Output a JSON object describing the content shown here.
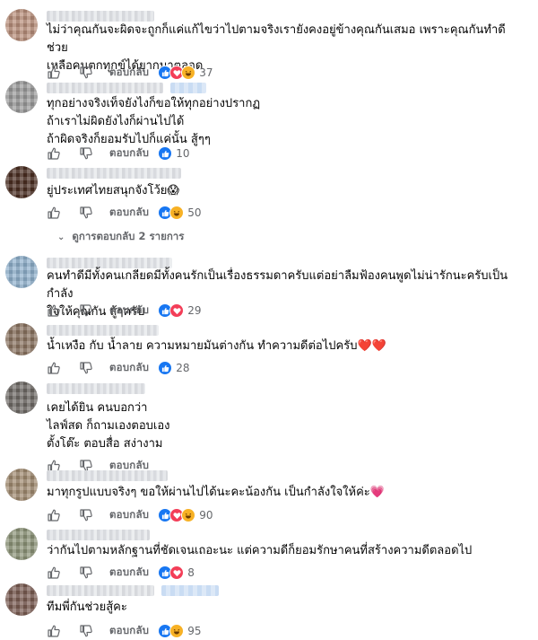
{
  "reply_label": "ตอบกลับ",
  "more_replies": "ดูการตอบกลับ 2 รายการ",
  "colors": {
    "like": "#1877f2",
    "love": "#f33e58",
    "haha": "#f7b125",
    "meta": "#65676b"
  },
  "comments": [
    {
      "text": "ไม่ว่าคุณกันจะผิดจะถูกก็แค่แก้ไขว่าไปตามจริงเรายังคงอยู่ข้างคุณกันเสมอ เพราะคุณกันทำดีช่วย\nเหลือคนตกทุกข์ได้ยากมาตลอด",
      "count": "37",
      "reactions": [
        "like",
        "love",
        "haha"
      ]
    },
    {
      "text": "ทุกอย่างจริงเท็จยังไงก็ขอให้ทุกอย่างปรากฏ\nถ้าเราไม่ผิดยังไงก็ผ่านไปได้\nถ้าผิดจริงก็ยอมรับไปก็แค่นั้น สู้ๆๆ",
      "count": "10",
      "reactions": [
        "like"
      ]
    },
    {
      "text": "ยู่ประเทศไทยสนุกจังโว้ย😱",
      "count": "50",
      "reactions": [
        "like",
        "haha"
      ]
    },
    {
      "text": "คนทำดีมีทั้งคนเกลียดมีทั้งคนรักเป็นเรื่องธรรมดาครับแต่อย่าลืมฟ้องคนพูดไม่น่ารักนะครับเป็นกำลัง\nใจให้คุณกัน สู้ๆครับ",
      "count": "29",
      "reactions": [
        "like",
        "love"
      ]
    },
    {
      "text": "น้ำเหงือ กับ น้ำลาย ความหมายมันต่างกัน ทำความดีต่อไปครับ❤️❤️",
      "count": "28",
      "reactions": [
        "like"
      ]
    },
    {
      "text": "เคยได้ยิน คนบอกว่า\nไลฟ์สด ก็ถามเองตอบเอง\nตั้งโต๊ะ ตอบสื่อ สง่างาม",
      "count": "",
      "reactions": []
    },
    {
      "text": "มาทุกรูปแบบจริงๆ ขอให้ผ่านไปได้นะคะน้องกัน เป็นกำลังใจให้ค่ะ💗",
      "count": "90",
      "reactions": [
        "like",
        "love",
        "haha"
      ]
    },
    {
      "text": "ว่ากันไปตามหลักฐานที่ชัดเจนเถอะนะ แต่ความดีก็ยอมรักษาคนที่สร้างความดีตลอดไป",
      "count": "8",
      "reactions": [
        "like",
        "love"
      ]
    },
    {
      "text": "ทีมพี่กันช่วยสู้คะ",
      "count": "95",
      "reactions": [
        "like",
        "haha"
      ]
    }
  ]
}
